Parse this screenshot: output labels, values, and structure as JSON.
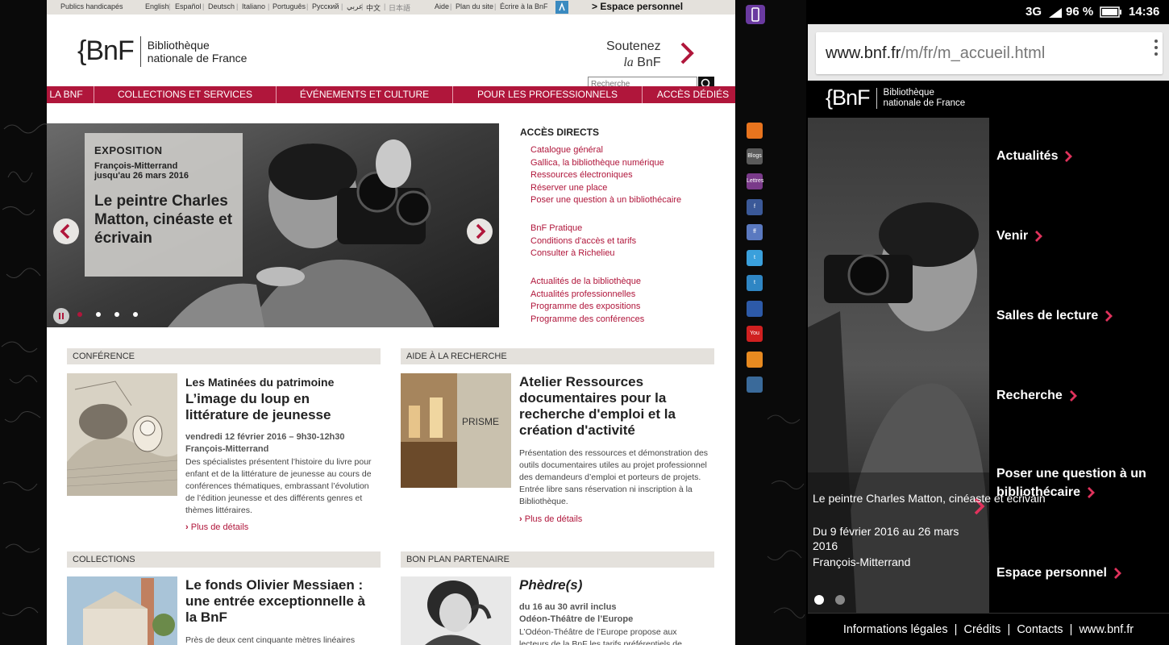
{
  "desktop": {
    "topbar": {
      "accessibility": "Publics handicapés",
      "languages": [
        "English",
        "Español",
        "Deutsch",
        "Italiano",
        "Português",
        "Русский",
        "عربي",
        "中文",
        "日本語"
      ],
      "links": [
        "Aide",
        "Plan du site",
        "Écrire à la BnF"
      ],
      "espace_personnel": "> Espace personnel"
    },
    "logo": {
      "mark": "{BnF",
      "line1": "Bibliothèque",
      "line2": "nationale de France"
    },
    "soutenez": {
      "line1": "Soutenez",
      "line2_italic": "la",
      "line2": "BnF"
    },
    "search": {
      "placeholder": "Recherche"
    },
    "nav": [
      "LA BNF",
      "COLLECTIONS ET SERVICES",
      "ÉVÉNEMENTS ET CULTURE",
      "POUR LES PROFESSIONNELS",
      "ACCÈS DÉDIÉS"
    ],
    "hero": {
      "kicker": "EXPOSITION",
      "place": "François-Mitterrand",
      "dates": "jusqu'au 26 mars 2016",
      "title": "Le peintre Charles Matton, cinéaste et écrivain",
      "slide_count": 4,
      "active_slide": 1
    },
    "acces_directs": {
      "title": "ACCÈS DIRECTS",
      "group1": [
        "Catalogue général",
        "Gallica, la bibliothèque numérique",
        "Ressources électroniques",
        "Réserver une place",
        "Poser une question à un bibliothécaire"
      ],
      "group2": [
        "BnF Pratique",
        "Conditions d'accès et tarifs",
        "Consulter à Richelieu"
      ],
      "group3": [
        "Actualités de la bibliothèque",
        "Actualités professionnelles",
        "Programme des expositions",
        "Programme des conférences"
      ]
    },
    "sections": {
      "conference": {
        "head": "CONFÉRENCE",
        "kicker": "Les Matinées du patrimoine",
        "title": "L’image du loup en littérature de jeunesse",
        "date": "vendredi 12 février 2016 – 9h30-12h30",
        "place": "François-Mitterrand",
        "body": "Des spécialistes présentent l’histoire du livre pour enfant et de la littérature de jeunesse au cours de conférences thématiques, embrassant l’évolution de l’édition jeunesse et des différents genres et thèmes littéraires.",
        "more": "Plus de détails"
      },
      "aide": {
        "head": "AIDE À LA RECHERCHE",
        "title": "Atelier Ressources documentaires pour la recherche d'emploi et la création d'activité",
        "thumb_text": "PRISME",
        "body": "Présentation des ressources et démonstration des outils documentaires utiles au projet professionnel des demandeurs d’emploi et porteurs de projets. Entrée libre sans réservation ni inscription à la Bibliothèque.",
        "more": "Plus de détails"
      },
      "collections": {
        "head": "COLLECTIONS",
        "title": "Le fonds Olivier Messiaen : une entrée exceptionnelle à la BnF",
        "body": "Près de deux cent cinquante mètres linéaires"
      },
      "bonplan": {
        "head": "BON PLAN PARTENAIRE",
        "title": "Phèdre(s)",
        "date": "du 16 au 30 avril inclus",
        "place": "Odéon-Théâtre de l’Europe",
        "body": "L’Odéon-Théâtre de l’Europe propose aux lecteurs de la BnF les tarifs préférentiels de"
      }
    },
    "social": [
      {
        "name": "rss-icon",
        "label": "",
        "color": "#e8741e"
      },
      {
        "name": "blogs-icon",
        "label": "Blogs",
        "color": "#5a5a5a"
      },
      {
        "name": "lettres-icon",
        "label": "Lettres",
        "color": "#7a3a8a"
      },
      {
        "name": "facebook-icon",
        "label": "f",
        "color": "#3b5998"
      },
      {
        "name": "facebook-alt-icon",
        "label": "ff",
        "color": "#5a79c0"
      },
      {
        "name": "twitter-icon",
        "label": "t",
        "color": "#3aa0dc"
      },
      {
        "name": "twitter-alt-icon",
        "label": "t",
        "color": "#2f86c4"
      },
      {
        "name": "gallica-icon",
        "label": "",
        "color": "#2d5aa8"
      },
      {
        "name": "youtube-icon",
        "label": "You",
        "color": "#d02020"
      },
      {
        "name": "scoop-icon",
        "label": "",
        "color": "#e88a20"
      },
      {
        "name": "instagram-icon",
        "label": "",
        "color": "#3a6a9a"
      }
    ]
  },
  "mobile": {
    "status": {
      "network": "3G",
      "battery": "96 %",
      "time": "14:36"
    },
    "url": {
      "domain": "www.bnf.fr",
      "path": "/m/fr/m_accueil.html"
    },
    "logo": {
      "mark": "{BnF",
      "line1": "Bibliothèque",
      "line2": "nationale de France"
    },
    "caption": {
      "title": "Le peintre Charles Matton, cinéaste et écrivain",
      "dates": "Du 9 février 2016 au 26 mars 2016",
      "place": "François-Mitterrand"
    },
    "menu": [
      "Actualités",
      "Venir",
      "Salles de lecture",
      "Recherche",
      "Poser une question à un bibliothécaire",
      "Espace personnel"
    ],
    "slide_count": 2,
    "active_slide": 0,
    "footer": [
      "Informations légales",
      "Crédits",
      "Contacts",
      "www.bnf.fr"
    ]
  },
  "colors": {
    "accent": "#b0163b",
    "nav_bg": "#b0163b",
    "section_head_bg": "#e4e1dc"
  }
}
